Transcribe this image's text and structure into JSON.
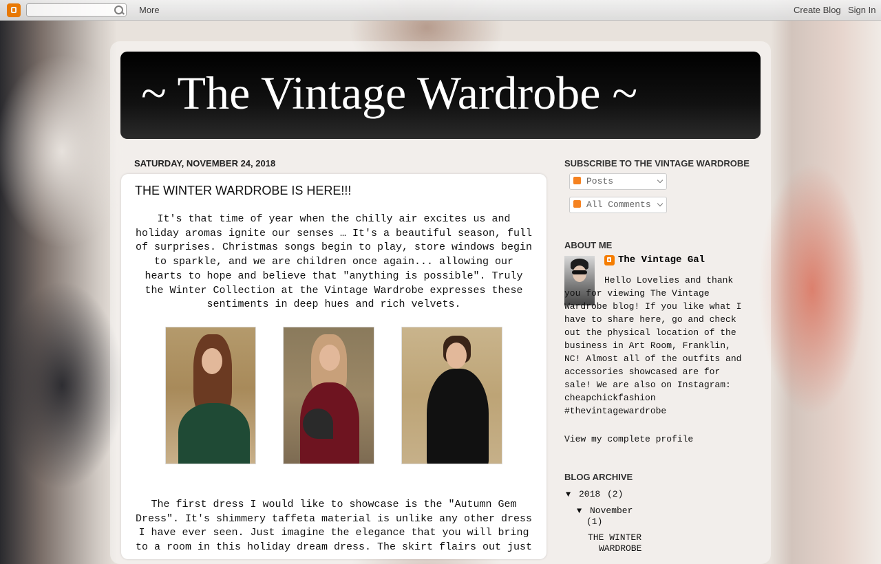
{
  "navbar": {
    "search_placeholder": "",
    "more_label": "More",
    "create_blog_label": "Create Blog",
    "sign_in_label": "Sign In"
  },
  "blog": {
    "title": "~ The Vintage Wardrobe ~"
  },
  "post": {
    "date": "SATURDAY, NOVEMBER 24, 2018",
    "title": "THE WINTER WARDROBE IS HERE!!!",
    "paragraph_1": "It's that time of year when the chilly air excites us and holiday aromas ignite our senses … It's a beautiful season, full of surprises. Christmas songs begin to play, store windows begin to sparkle, and we are children once again... allowing our hearts to hope and believe that \"anything is possible\". Truly the Winter Collection at the Vintage Wardrobe expresses these sentiments in deep hues and rich velvets.",
    "paragraph_2": "The first dress I would like to showcase is the \"Autumn Gem Dress\". It's shimmery taffeta material is unlike any other dress I have ever seen. Just imagine the elegance that you will bring to a room in this holiday dream dress. The skirt flairs out just",
    "photos": [
      {
        "subject": "model in green off-shoulder dress",
        "color": "#1f4a35"
      },
      {
        "subject": "model in red velvet dress with fan",
        "color": "#6e1420"
      },
      {
        "subject": "model in black velvet dress",
        "color": "#111111"
      }
    ]
  },
  "sidebar": {
    "subscribe": {
      "heading": "SUBSCRIBE TO THE VINTAGE WARDROBE",
      "posts_label": "Posts",
      "comments_label": "All Comments"
    },
    "about": {
      "heading": "ABOUT ME",
      "name": "The Vintage Gal",
      "description": "Hello Lovelies and thank you for viewing The Vintage Wardrobe blog! If you like what I have to share here, go and check out the physical location of the business in Art Room, Franklin, NC! Almost all of the outfits and accessories showcased are for sale! We are also on Instagram: cheapchickfashion #thevintagewardrobe",
      "view_profile_label": "View my complete profile"
    },
    "archive": {
      "heading": "BLOG ARCHIVE",
      "year_toggle": "▼",
      "year": "2018",
      "year_count": "(2)",
      "month_toggle": "▼",
      "month": "November",
      "month_count": "(1)",
      "post_line_1": "THE WINTER",
      "post_line_2": "WARDROBE"
    }
  },
  "colors": {
    "header_bg": "#000000",
    "blogger_orange": "#f57d00",
    "feed_orange": "#f58220"
  }
}
